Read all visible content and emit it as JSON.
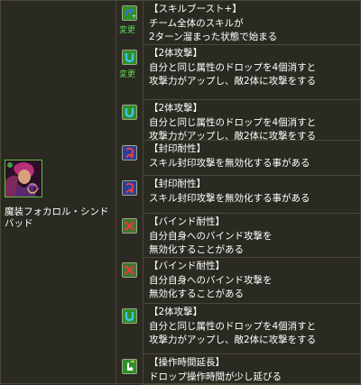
{
  "character": {
    "name": "魔装フォカロル・シンドバッド"
  },
  "awakenings": [
    {
      "icon": "skill-boost-plus-icon",
      "badge": "変更",
      "lines": [
        "【スキルブースト+】",
        "チーム全体のスキルが",
        "2ターン溜まった状態で始まる"
      ]
    },
    {
      "icon": "two-pronged-attack-icon",
      "badge": "変更",
      "lines": [
        "【2体攻撃】",
        "自分と同じ属性のドロップを4個消すと",
        "攻撃力がアップし、敵2体に攻撃をする"
      ]
    },
    {
      "icon": "two-pronged-attack-icon",
      "badge": "",
      "lines": [
        "【2体攻撃】",
        "自分と同じ属性のドロップを4個消すと",
        "攻撃力がアップし、敵2体に攻撃をする"
      ]
    },
    {
      "icon": "skill-bind-resist-icon",
      "badge": "",
      "lines": [
        "【封印耐性】",
        "スキル封印攻撃を無効化する事がある"
      ]
    },
    {
      "icon": "skill-bind-resist-icon",
      "badge": "",
      "lines": [
        "【封印耐性】",
        "スキル封印攻撃を無効化する事がある"
      ]
    },
    {
      "icon": "bind-resist-icon",
      "badge": "",
      "lines": [
        "【バインド耐性】",
        "自分自身へのバインド攻撃を",
        "無効化することがある"
      ]
    },
    {
      "icon": "bind-resist-icon",
      "badge": "",
      "lines": [
        "【バインド耐性】",
        "自分自身へのバインド攻撃を",
        "無効化することがある"
      ]
    },
    {
      "icon": "two-pronged-attack-icon",
      "badge": "",
      "lines": [
        "【2体攻撃】",
        "自分と同じ属性のドロップを4個消すと",
        "攻撃力がアップし、敵2体に攻撃をする"
      ]
    },
    {
      "icon": "extend-time-icon",
      "badge": "",
      "lines": [
        "【操作時間延長】",
        "ドロップ操作時間が少し延びる"
      ]
    }
  ],
  "colors": {
    "background": "#2b2a22",
    "border": "#4a4836",
    "change_badge": "#5fd55a",
    "icon_green": "#2f8f2a"
  }
}
